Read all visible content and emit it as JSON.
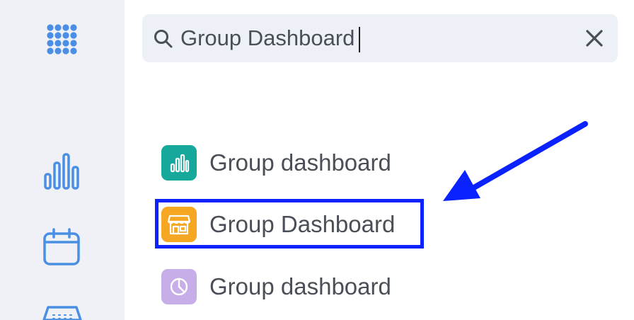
{
  "sidebar": {
    "icons": [
      "apps-grid-icon",
      "bar-chart-icon",
      "calendar-icon",
      "store-icon"
    ]
  },
  "search": {
    "value": "Group Dashboard",
    "icon": "search-icon",
    "clear_icon": "close-icon"
  },
  "results": [
    {
      "label": "Group dashboard",
      "icon": "bar-chart-icon",
      "color": "#16a99b"
    },
    {
      "label": "Group Dashboard",
      "icon": "storefront-icon",
      "color": "#f5a623"
    },
    {
      "label": "Group dashboard",
      "icon": "pie-chart-icon",
      "color": "#c8aee9"
    }
  ],
  "annotation": {
    "highlight_color": "#0a22ff",
    "arrow_color": "#0a22ff"
  },
  "colors": {
    "sidebar_bg": "#eff1f7",
    "sidebar_icon": "#4a8fe3",
    "search_bg": "#edf0f6",
    "text": "#4a4f57"
  }
}
